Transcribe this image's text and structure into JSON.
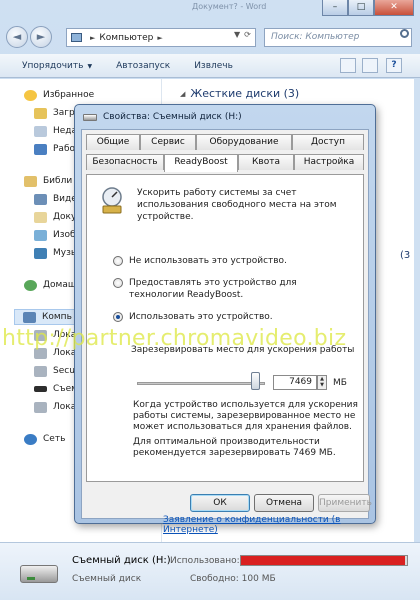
{
  "window": {
    "title_ghost": "Документ? - Word",
    "minimize": "–",
    "maximize": "□",
    "close": "✕"
  },
  "address_bar": {
    "back": "◄",
    "forward": "►",
    "path": "Компьютер",
    "search_placeholder": "Поиск: Компьютер"
  },
  "toolbar": {
    "organize": "Упорядочить",
    "autoplay": "Автозапуск",
    "eject": "Извлечь"
  },
  "sidebar": {
    "favorites": "Избранное",
    "favorites_items": [
      "Загру",
      "Неда",
      "Рабо"
    ],
    "libraries": "Библи",
    "libraries_items": [
      "Виде",
      "Доку",
      "Изоб",
      "Музы"
    ],
    "homegroup": "Домаш",
    "computer": "Компь",
    "computer_items": [
      "Лока",
      "Лока",
      "Secu",
      "Съемн",
      "Лока"
    ],
    "network": "Сеть"
  },
  "main": {
    "section_heading": "Жесткие диски (3)",
    "second_count": "(3"
  },
  "dialog": {
    "title": "Свойства: Съемный диск (H:)",
    "tabs_row1": [
      "Общие",
      "Сервис",
      "Оборудование",
      "Доступ"
    ],
    "tabs_row2": [
      "Безопасность",
      "ReadyBoost",
      "Квота",
      "Настройка"
    ],
    "active_tab": "ReadyBoost",
    "description": "Ускорить работу системы за счет использования свободного места на этом устройстве.",
    "options": [
      {
        "label": "Не использовать это устройство.",
        "checked": false
      },
      {
        "label": "Предоставлять это устройство для технологии ReadyBoost.",
        "checked": false
      },
      {
        "label": "Использовать это устройство.",
        "checked": true
      }
    ],
    "reserve_label": "Зарезервировать место для ускорения работы",
    "slider_fraction": 0.92,
    "reserve_value": "7469",
    "unit": "МБ",
    "info_in_use": "Когда устройство используется для ускорения работы системы, зарезервированное место не может использоваться для хранения файлов.",
    "info_recommend": "Для оптимальной производительности рекомендуется зарезервировать 7469 МБ.",
    "privacy_link": "Заявление о конфиденциальности (в Интернете)",
    "buttons": {
      "ok": "ОК",
      "cancel": "Отмена",
      "apply": "Применить"
    }
  },
  "details": {
    "drive_name": "Съемный диск (H:)",
    "drive_type": "Съемный диск",
    "used_label": "Использовано:",
    "free_label": "Свободно: 100 МБ",
    "used_fraction": 0.99,
    "bar_color": "#d92020"
  },
  "watermark": "http://partner.chromavideo.biz"
}
